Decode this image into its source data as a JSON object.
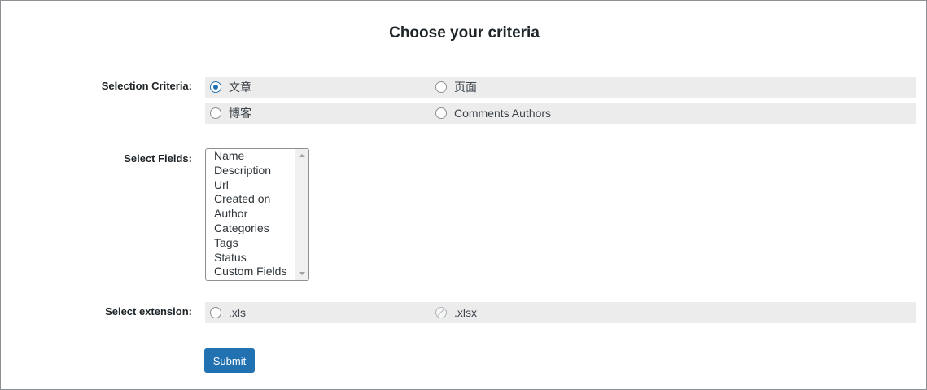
{
  "form": {
    "title": "Choose your criteria",
    "selection_criteria": {
      "label": "Selection Criteria:",
      "options": [
        {
          "label": "文章",
          "checked": true
        },
        {
          "label": "页面",
          "checked": false
        },
        {
          "label": "博客",
          "checked": false
        },
        {
          "label": "Comments Authors",
          "checked": false
        }
      ]
    },
    "select_fields": {
      "label": "Select Fields:",
      "options": [
        "Name",
        "Description",
        "Url",
        "Created on",
        "Author",
        "Categories",
        "Tags",
        "Status",
        "Custom Fields"
      ]
    },
    "select_extension": {
      "label": "Select extension:",
      "options": [
        {
          "label": ".xls",
          "checked": false,
          "disabled": false
        },
        {
          "label": ".xlsx",
          "checked": false,
          "disabled": true
        }
      ]
    },
    "submit_label": "Submit"
  },
  "colors": {
    "accent": "#2271b1",
    "row_background": "#ececec",
    "text": "#3c434a"
  }
}
